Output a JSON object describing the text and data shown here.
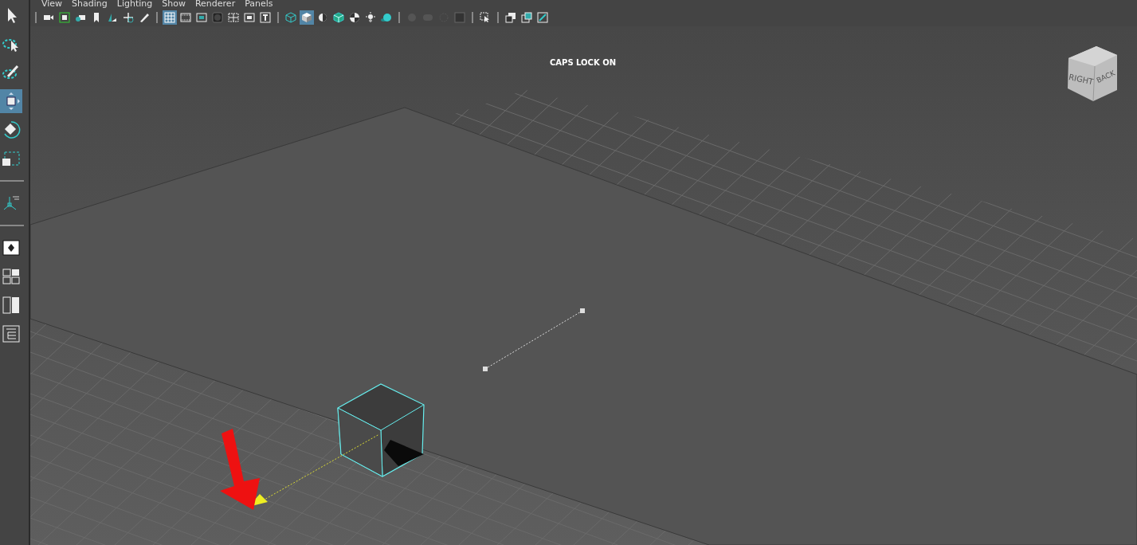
{
  "menu": [
    "View",
    "Shading",
    "Lighting",
    "Show",
    "Renderer",
    "Panels"
  ],
  "toolbar": {
    "groups": [
      {
        "items": [
          {
            "kind": "camera",
            "selected": false
          },
          {
            "kind": "camera-lock",
            "selected": false
          },
          {
            "kind": "camera-attr",
            "selected": false
          },
          {
            "kind": "bookmark",
            "selected": false
          },
          {
            "kind": "image-plane",
            "selected": false
          },
          {
            "kind": "pan",
            "selected": false
          },
          {
            "kind": "pencil",
            "selected": false
          }
        ]
      },
      {
        "items": [
          {
            "kind": "grid",
            "selected": true
          },
          {
            "kind": "film",
            "selected": false
          },
          {
            "kind": "gate",
            "selected": false
          },
          {
            "kind": "mask",
            "selected": false
          },
          {
            "kind": "field",
            "selected": false
          },
          {
            "kind": "safe",
            "selected": false
          },
          {
            "kind": "title",
            "selected": false
          }
        ]
      },
      {
        "items": [
          {
            "kind": "wire-cube",
            "selected": false
          },
          {
            "kind": "shaded-cube",
            "selected": true
          },
          {
            "kind": "half",
            "selected": false
          },
          {
            "kind": "wire-on-shaded",
            "selected": false
          },
          {
            "kind": "textures",
            "selected": false
          },
          {
            "kind": "light",
            "selected": false
          },
          {
            "kind": "sphere",
            "selected": false
          }
        ]
      },
      {
        "items": [
          {
            "kind": "dim-sphere",
            "selected": false
          },
          {
            "kind": "dim-pill",
            "selected": false
          },
          {
            "kind": "dim-ring",
            "selected": false
          },
          {
            "kind": "square",
            "selected": false
          }
        ]
      },
      {
        "items": [
          {
            "kind": "isolate",
            "selected": false
          }
        ]
      },
      {
        "items": [
          {
            "kind": "panels",
            "selected": false
          },
          {
            "kind": "panel-swap",
            "selected": false
          },
          {
            "kind": "maximize",
            "selected": false
          }
        ]
      }
    ]
  },
  "tools": {
    "groups": [
      {
        "items": [
          {
            "kind": "select",
            "selected": false
          },
          {
            "kind": "lasso",
            "selected": false
          },
          {
            "kind": "paint",
            "selected": false
          },
          {
            "kind": "move",
            "selected": true
          },
          {
            "kind": "rotate",
            "selected": false
          },
          {
            "kind": "scale",
            "selected": false
          }
        ]
      },
      {
        "items": [
          {
            "kind": "manip",
            "selected": false
          }
        ]
      },
      {
        "items": [
          {
            "kind": "layout-single",
            "selected": false
          },
          {
            "kind": "layout-four",
            "selected": false
          },
          {
            "kind": "layout-two",
            "selected": false
          },
          {
            "kind": "outliner",
            "selected": false
          }
        ]
      }
    ]
  },
  "viewport": {
    "notice": "CAPS LOCK ON",
    "view_cube": {
      "faces": [
        "RIGHT",
        "BACK"
      ]
    }
  }
}
